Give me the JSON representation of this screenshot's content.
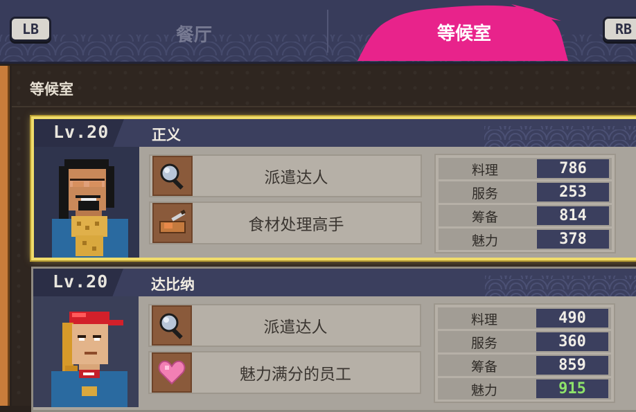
{
  "topbar": {
    "left_button": "LB",
    "right_button": "RB",
    "tabs": [
      {
        "label": "餐厅",
        "active": false
      },
      {
        "label": "等候室",
        "active": true
      }
    ],
    "active_color": "#e8238b"
  },
  "section": {
    "title": "等候室"
  },
  "staff": [
    {
      "level": "Lv.20",
      "name": "正义",
      "selected": true,
      "skills": [
        {
          "label": "派遣达人",
          "icon": "magnifier-icon"
        },
        {
          "label": "食材处理高手",
          "icon": "cutting-board-icon"
        }
      ],
      "stats": [
        {
          "name": "料理",
          "value": "786"
        },
        {
          "name": "服务",
          "value": "253"
        },
        {
          "name": "筹备",
          "value": "814"
        },
        {
          "name": "魅力",
          "value": "378"
        }
      ]
    },
    {
      "level": "Lv.20",
      "name": "达比纳",
      "selected": false,
      "skills": [
        {
          "label": "派遣达人",
          "icon": "magnifier-icon"
        },
        {
          "label": "魅力满分的员工",
          "icon": "heart-icon"
        }
      ],
      "stats": [
        {
          "name": "料理",
          "value": "490"
        },
        {
          "name": "服务",
          "value": "360"
        },
        {
          "name": "筹备",
          "value": "859"
        },
        {
          "name": "魅力",
          "value": "915",
          "highlight": "#8ee36a"
        }
      ]
    }
  ]
}
